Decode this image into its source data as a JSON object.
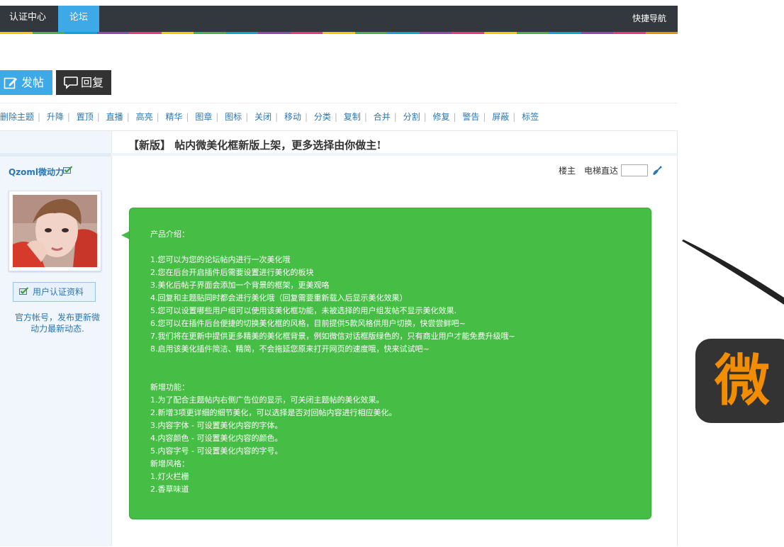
{
  "topbar": {
    "tabs": [
      {
        "label": "认证中心"
      },
      {
        "label": "论坛"
      }
    ],
    "quick_nav": "快捷导航"
  },
  "actions": {
    "post_label": "发帖",
    "reply_label": "回复"
  },
  "moderation": [
    "删除主题",
    "升降",
    "置顶",
    "直播",
    "高亮",
    "精华",
    "图章",
    "图标",
    "关闭",
    "移动",
    "分类",
    "复制",
    "合并",
    "分割",
    "修复",
    "警告",
    "屏蔽",
    "标签"
  ],
  "post": {
    "title": "【新版】 帖内微美化框新版上架，更多选择由你做主!",
    "author": "Qzoml微动力",
    "auth_button": "用户认证资料",
    "official_note": "官方帐号，发布更新微动力最新动态.",
    "floor_owner": "楼主",
    "floor_jump": "电梯直达",
    "content_lines": [
      "产品介绍：",
      "",
      "1.您可以为您的论坛帖内进行一次美化哦",
      "2.您在后台开启插件后需要设置进行美化的板块",
      "3.美化后帖子界面会添加一个背景的框架，更美观咯",
      "4.回复和主题贴同时都会进行美化哦（回复需要重新载入后显示美化效果）",
      "5.您可以设置哪些用户组可以使用该美化框功能，未被选择的用户组发帖不显示美化效果.",
      "6.您可以在插件后台便捷的切换美化框的风格，目前提供5款风格供用户切换，快尝尝鲜吧~",
      "7.我们将在更新中提供更多精美的美化框背景，例如微信对话框版绿色的，只有商业用户才能免费升级哦~",
      "8.启用该美化插件简洁、精简，不会拖延您原来打开网页的速度哦，快来试试吧~",
      "",
      "",
      "新增功能：",
      "1.为了配合主题帖内右侧广告位的显示，可关闭主题帖的美化效果。",
      "2.新增3项更详细的细节美化，可以选择是否对回帖内容进行相应美化。",
      "3.内容字体  - 可设置美化内容的字体。",
      "4.内容颜色  - 可设置美化内容的颜色。",
      "5.内容字号  - 可设置美化内容的字号。",
      "新增风格：",
      "1.灯火栏栅",
      "2.香草味道"
    ]
  },
  "ad": {
    "text": "微"
  },
  "colors": {
    "topbar": "#33383e",
    "accent_blue": "#3da9e6",
    "bubble_green": "#46bd45",
    "ad_orange": "#f28c00"
  }
}
